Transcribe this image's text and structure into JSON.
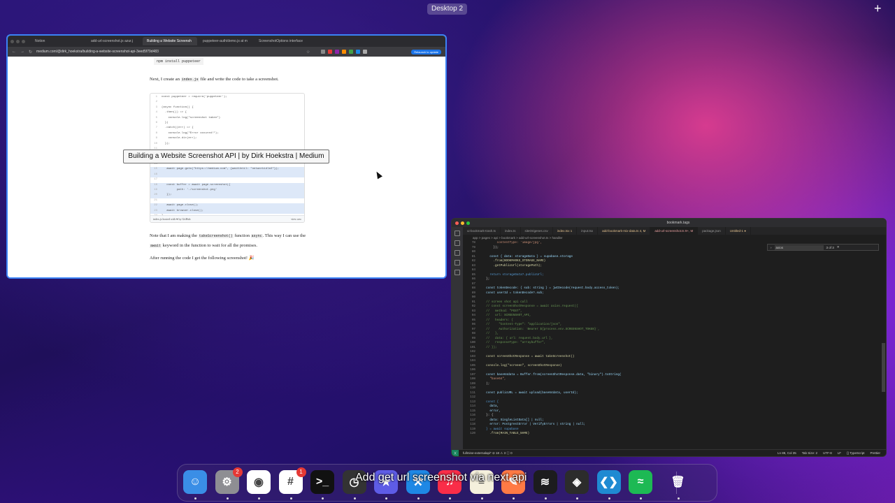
{
  "desktop": {
    "label": "Desktop 2",
    "add_button": "+"
  },
  "browser": {
    "tabs": [
      "Notion",
      "add-url-screenshot.js azur.j",
      "Building a Website Screensh",
      "puppeteer-auth/demo.js at m",
      "ScreenshotOptions interface"
    ],
    "active_tab": 2,
    "url": "medium.com/@dirk_hoekstra/building-a-website-screenshot-api-3eed5f79d483",
    "update_button": "Relaunch to update",
    "extension_colors": [
      "#888888",
      "#e53935",
      "#8e24aa",
      "#fb8c00",
      "#43a047",
      "#1e88e5",
      "#aaaaaa"
    ],
    "article": {
      "top_code": "npm install puppeteer",
      "intro_before": "Next, I create an ",
      "intro_code": "index.js",
      "intro_after": " file and write the code to take a screenshot.",
      "gist_lines": [
        {
          "n": "1",
          "t": "const puppeteer = require('puppeteer');",
          "hl": false
        },
        {
          "n": "2",
          "t": "",
          "hl": false
        },
        {
          "n": "3",
          "t": "(async function() {",
          "hl": false
        },
        {
          "n": "4",
          "t": "  .then(() => {",
          "hl": false
        },
        {
          "n": "5",
          "t": "    console.log(\"screenshot taken\")",
          "hl": false
        },
        {
          "n": "6",
          "t": "  })",
          "hl": false
        },
        {
          "n": "7",
          "t": "  .catch((err) => {",
          "hl": false
        },
        {
          "n": "8",
          "t": "    console.log(\"Error occured!\");",
          "hl": false
        },
        {
          "n": "9",
          "t": "    console.dir(err);",
          "hl": false
        },
        {
          "n": "10",
          "t": "  });",
          "hl": false
        },
        {
          "n": "11",
          "t": "",
          "hl": false
        },
        {
          "n": "12",
          "t": "",
          "hl": false
        },
        {
          "n": "13",
          "t": "",
          "hl": false
        },
        {
          "n": "14",
          "t": "",
          "hl": false
        },
        {
          "n": "15",
          "t": "   await page.goto(\"https://medium.com\", {waitUntil: \"networkidle2\"});",
          "hl": true
        },
        {
          "n": "16",
          "t": "",
          "hl": true
        },
        {
          "n": "17",
          "t": "",
          "hl": false
        },
        {
          "n": "18",
          "t": "   const buffer = await page.screenshot({",
          "hl": true
        },
        {
          "n": "19",
          "t": "         path: './screenshot.png'",
          "hl": true
        },
        {
          "n": "20",
          "t": "   });",
          "hl": true
        },
        {
          "n": "21",
          "t": "",
          "hl": false
        },
        {
          "n": "22",
          "t": "   await page.close();",
          "hl": true
        },
        {
          "n": "23",
          "t": "   await browser.close();",
          "hl": true
        },
        {
          "n": "24",
          "t": "}",
          "hl": false
        }
      ],
      "gist_footer_left": "index.js hosted with ♥ by GitHub",
      "gist_footer_right": "view raw",
      "para2_before": "Note that I am making the ",
      "para2_code": "takeScreenshot()",
      "para2_mid": " function ",
      "para2_code2": "async",
      "para2_after": ". This way I can use the ",
      "para2_code3": "await",
      "para2_end": " keyword in the function to wait for all the promises.",
      "para3": "After running the code I get the following screenshot! 🎉"
    },
    "tooltip": "Building a Website Screenshot API | by Dirk Hoekstra | Medium"
  },
  "vscode": {
    "title": "bookmark.tags",
    "tabs": [
      {
        "label": "ui-bookmark-trash.ts",
        "cls": ""
      },
      {
        "label": "index.ts",
        "cls": ""
      },
      {
        "label": "siteOrigenes.csv",
        "cls": ""
      },
      {
        "label": "index.tsx 1",
        "cls": "mod"
      },
      {
        "label": "input.tsx",
        "cls": ""
      },
      {
        "label": "add-bookmark-mix-data.ts 4, M",
        "cls": "mod"
      },
      {
        "label": "add-url-screenshot.ts 9+, M",
        "cls": "active"
      },
      {
        "label": "package.json",
        "cls": ""
      },
      {
        "label": "Untitled-1 ●",
        "cls": "mod"
      }
    ],
    "breadcrumb": "app > pages > api > bookmark > add-url-screenshot.ts > handler",
    "find_value": "axios",
    "find_result": "3 of 3",
    "lines": [
      {
        "n": "78",
        "t": "        contentType: 'image/jpg',",
        "c": "st"
      },
      {
        "n": "79",
        "t": "      });",
        "c": ""
      },
      {
        "n": "80",
        "t": "",
        "c": ""
      },
      {
        "n": "81",
        "t": "    const { data: storageData } = supabase.storage",
        "c": "vr"
      },
      {
        "n": "82",
        "t": "      .from(BOOKMARKS_STORAGE_NAME)",
        "c": "fn"
      },
      {
        "n": "83",
        "t": "      .getPublicUrl(storagePath);",
        "c": "fn"
      },
      {
        "n": "84",
        "t": "",
        "c": ""
      },
      {
        "n": "85",
        "t": "    return storageData?.publicUrl;",
        "c": "kw"
      },
      {
        "n": "86",
        "t": "  };",
        "c": ""
      },
      {
        "n": "87",
        "t": "",
        "c": ""
      },
      {
        "n": "88",
        "t": "  const tokenDecode: { sub: string } = jwtDecode(request.body.access_token);",
        "c": "vr"
      },
      {
        "n": "89",
        "t": "  const userId = tokenDecode?.sub;",
        "c": "vr"
      },
      {
        "n": "90",
        "t": "",
        "c": ""
      },
      {
        "n": "91",
        "t": "  // screen shot api call",
        "c": "cm"
      },
      {
        "n": "92",
        "t": "  // const screenShotResponse = await axios.request({",
        "c": "cm"
      },
      {
        "n": "93",
        "t": "  //   method: \"POST\",",
        "c": "cm"
      },
      {
        "n": "94",
        "t": "  //   url: SCREENSHOT_API,",
        "c": "cm"
      },
      {
        "n": "95",
        "t": "  //   headers: {",
        "c": "cm"
      },
      {
        "n": "96",
        "t": "  //     \"Content-Type\": \"application/json\",",
        "c": "cm"
      },
      {
        "n": "97",
        "t": "  //     Authorization: `Bearer ${process.env.SCREENSHOT_TOKEN}`,",
        "c": "cm"
      },
      {
        "n": "98",
        "t": "  //   },",
        "c": "cm"
      },
      {
        "n": "99",
        "t": "  //   data: { url: request.body.url },",
        "c": "cm"
      },
      {
        "n": "100",
        "t": "  //   responseType: \"arraybuffer\",",
        "c": "cm"
      },
      {
        "n": "101",
        "t": "  // });",
        "c": "cm"
      },
      {
        "n": "102",
        "t": "",
        "c": ""
      },
      {
        "n": "103",
        "t": "  const screenShotResponse = await takeScreenshot()",
        "c": "fn"
      },
      {
        "n": "104",
        "t": "",
        "c": ""
      },
      {
        "n": "105",
        "t": "  console.log(\"screeen\", screenShotResponse)",
        "c": "fn"
      },
      {
        "n": "106",
        "t": "",
        "c": ""
      },
      {
        "n": "107",
        "t": "  const base64data = Buffer.from(screenShotResponse.data, \"binary\").toString(",
        "c": "vr"
      },
      {
        "n": "108",
        "t": "    \"base64\",",
        "c": "st"
      },
      {
        "n": "109",
        "t": "  );",
        "c": ""
      },
      {
        "n": "110",
        "t": "",
        "c": ""
      },
      {
        "n": "111",
        "t": "  const publicURL = await upload(base64data, userId);",
        "c": "vr"
      },
      {
        "n": "112",
        "t": "",
        "c": ""
      },
      {
        "n": "113",
        "t": "  const {",
        "c": "kw"
      },
      {
        "n": "114",
        "t": "    data,",
        "c": "vr"
      },
      {
        "n": "115",
        "t": "    error,",
        "c": "vr"
      },
      {
        "n": "116",
        "t": "  }: {",
        "c": ""
      },
      {
        "n": "117",
        "t": "    data: SingleListData[] | null;",
        "c": "vr"
      },
      {
        "n": "118",
        "t": "    error: PostgrestError | VerifyErrors | string | null;",
        "c": "vr"
      },
      {
        "n": "119",
        "t": "  } = await supabase",
        "c": "kw"
      },
      {
        "n": "120",
        "t": "    .from(MAIN_TABLE_NAME)",
        "c": "fn"
      }
    ],
    "status_left": "fullmine-externalapi*  ⊘ 18 ⚠ 3  ⓘ 0",
    "status_right": [
      "Ln 88, Col 35",
      "Tab Size: 2",
      "UTF-8",
      "LF",
      "{} TypeScript",
      "Prettier"
    ]
  },
  "dock": {
    "apps": [
      {
        "name": "finder-icon",
        "glyph": "☺",
        "bg": "#3a8ee6",
        "badge": ""
      },
      {
        "name": "system-settings-icon",
        "glyph": "⚙",
        "bg": "#8e8e93",
        "badge": "2"
      },
      {
        "name": "chrome-icon",
        "glyph": "◉",
        "bg": "#ffffff",
        "badge": ""
      },
      {
        "name": "slack-icon",
        "glyph": "#",
        "bg": "#ffffff",
        "badge": "1"
      },
      {
        "name": "terminal-icon",
        "glyph": ">_",
        "bg": "#111111",
        "badge": ""
      },
      {
        "name": "screen-recorder-icon",
        "glyph": "◷",
        "bg": "#333333",
        "badge": ""
      },
      {
        "name": "linear-icon",
        "glyph": "★",
        "bg": "#5e5ce6",
        "badge": ""
      },
      {
        "name": "xcode-tools-icon",
        "glyph": "⚒",
        "bg": "#1e88e5",
        "badge": ""
      },
      {
        "name": "music-icon",
        "glyph": "♫",
        "bg": "#fa2d48",
        "badge": ""
      },
      {
        "name": "notes-icon",
        "glyph": "≡",
        "bg": "#f5f0dc",
        "badge": ""
      },
      {
        "name": "pages-icon",
        "glyph": "✎",
        "bg": "#ff7a45",
        "badge": ""
      },
      {
        "name": "activity-monitor-icon",
        "glyph": "≋",
        "bg": "#1c1c1e",
        "badge": ""
      },
      {
        "name": "figma-icon",
        "glyph": "◈",
        "bg": "#2c2c2c",
        "badge": ""
      },
      {
        "name": "vscode-icon",
        "glyph": "❮❯",
        "bg": "#1f8ad2",
        "badge": ""
      },
      {
        "name": "spotify-icon",
        "glyph": "≈",
        "bg": "#1db954",
        "badge": ""
      },
      {
        "name": "trash-icon",
        "glyph": "🗑",
        "bg": "transparent",
        "badge": ""
      }
    ]
  },
  "caption": "Add get url screenshot via next api"
}
